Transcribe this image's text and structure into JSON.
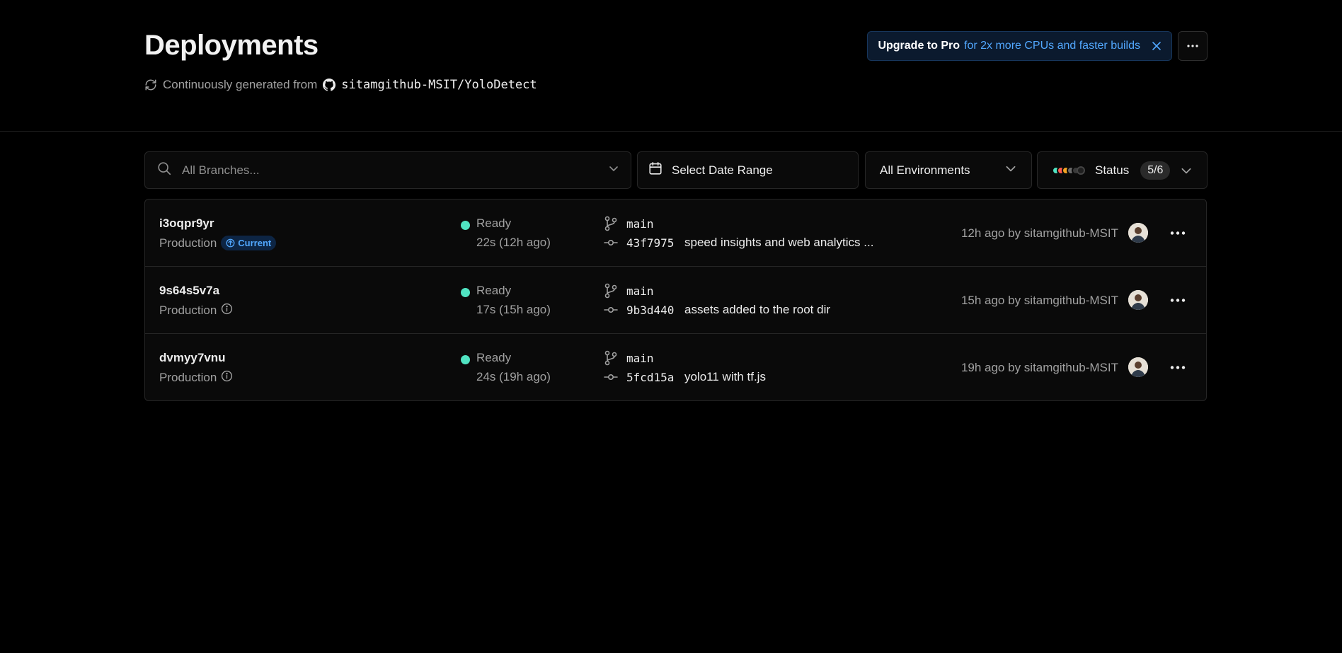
{
  "header": {
    "title": "Deployments",
    "generated_prefix": "Continuously generated from",
    "repo": "sitamgithub-MSIT/YoloDetect",
    "upgrade": {
      "strong": "Upgrade to Pro",
      "rest": "for 2x more CPUs and faster builds"
    }
  },
  "filters": {
    "branch_placeholder": "All Branches...",
    "date_label": "Select Date Range",
    "env_label": "All Environments",
    "status_label": "Status",
    "status_count": "5/6"
  },
  "colors": {
    "ready": "#50e3c2",
    "accent_blue": "#52a8ff"
  },
  "deployments": [
    {
      "id": "i3oqpr9yr",
      "environment": "Production",
      "current_badge": "Current",
      "status": "Ready",
      "duration": "22s (12h ago)",
      "branch": "main",
      "sha": "43f7975",
      "message": "speed insights and web analytics ...",
      "author": "12h ago by sitamgithub-MSIT"
    },
    {
      "id": "9s64s5v7a",
      "environment": "Production",
      "status": "Ready",
      "duration": "17s (15h ago)",
      "branch": "main",
      "sha": "9b3d440",
      "message": "assets added to the root dir",
      "author": "15h ago by sitamgithub-MSIT"
    },
    {
      "id": "dvmyy7vnu",
      "environment": "Production",
      "status": "Ready",
      "duration": "24s (19h ago)",
      "branch": "main",
      "sha": "5fcd15a",
      "message": "yolo11 with tf.js",
      "author": "19h ago by sitamgithub-MSIT"
    }
  ]
}
